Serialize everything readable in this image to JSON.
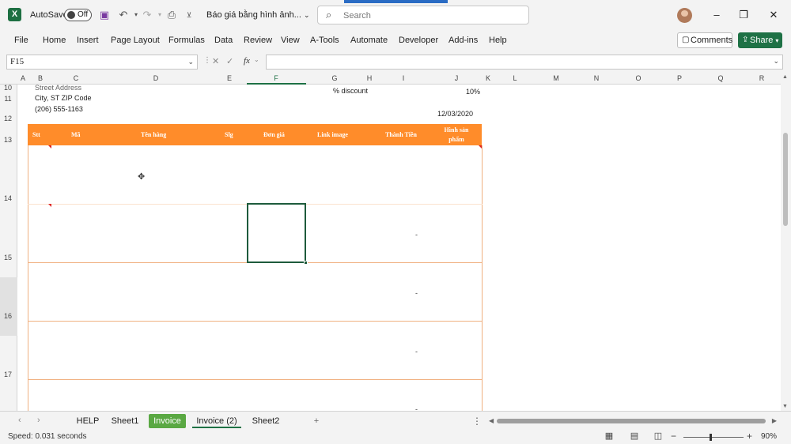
{
  "titlebar": {
    "autosave_label": "AutoSave",
    "autosave_state": "Off",
    "doc_title": "Báo giá bằng hình ảnh...",
    "search_placeholder": "Search"
  },
  "ribbon_tabs": [
    "File",
    "Home",
    "Insert",
    "Page Layout",
    "Formulas",
    "Data",
    "Review",
    "View",
    "A-Tools",
    "Automate",
    "Developer",
    "Add-ins",
    "Help"
  ],
  "ribbon_buttons": {
    "comments": "Comments",
    "share": "Share"
  },
  "formula_bar": {
    "name_box": "F15",
    "fx": "fx",
    "formula": ""
  },
  "columns": [
    "A",
    "B",
    "C",
    "D",
    "E",
    "F",
    "G",
    "H",
    "I",
    "J",
    "K",
    "L",
    "M",
    "N",
    "O",
    "P",
    "Q",
    "R"
  ],
  "selected_column": "F",
  "rows": [
    "10",
    "11",
    "12",
    "13",
    "14",
    "15",
    "16",
    "17"
  ],
  "sheet_content": {
    "address1": "Street Address",
    "address2": "City, ST  ZIP Code",
    "phone": "(206) 555-1163",
    "discount_label": "% discount",
    "discount_value": "10%",
    "date": "12/03/2020"
  },
  "table_headers": [
    "Stt",
    "Mã",
    "Tên hàng",
    "Slg",
    "Đơn giá",
    "Link image",
    "Thành Tiền",
    "Hình sản phẩm"
  ],
  "row_dash": "-",
  "sheet_tabs": [
    "HELP",
    "Sheet1",
    "Invoice",
    "Invoice (2)",
    "Sheet2"
  ],
  "active_sheet": "Invoice (2)",
  "status": {
    "text": "Speed: 0.031 seconds",
    "zoom": "90%"
  },
  "colors": {
    "excel_green": "#1e7145",
    "table_header_orange": "#ff8c2a",
    "invoice_tab_green": "#5aa843"
  }
}
